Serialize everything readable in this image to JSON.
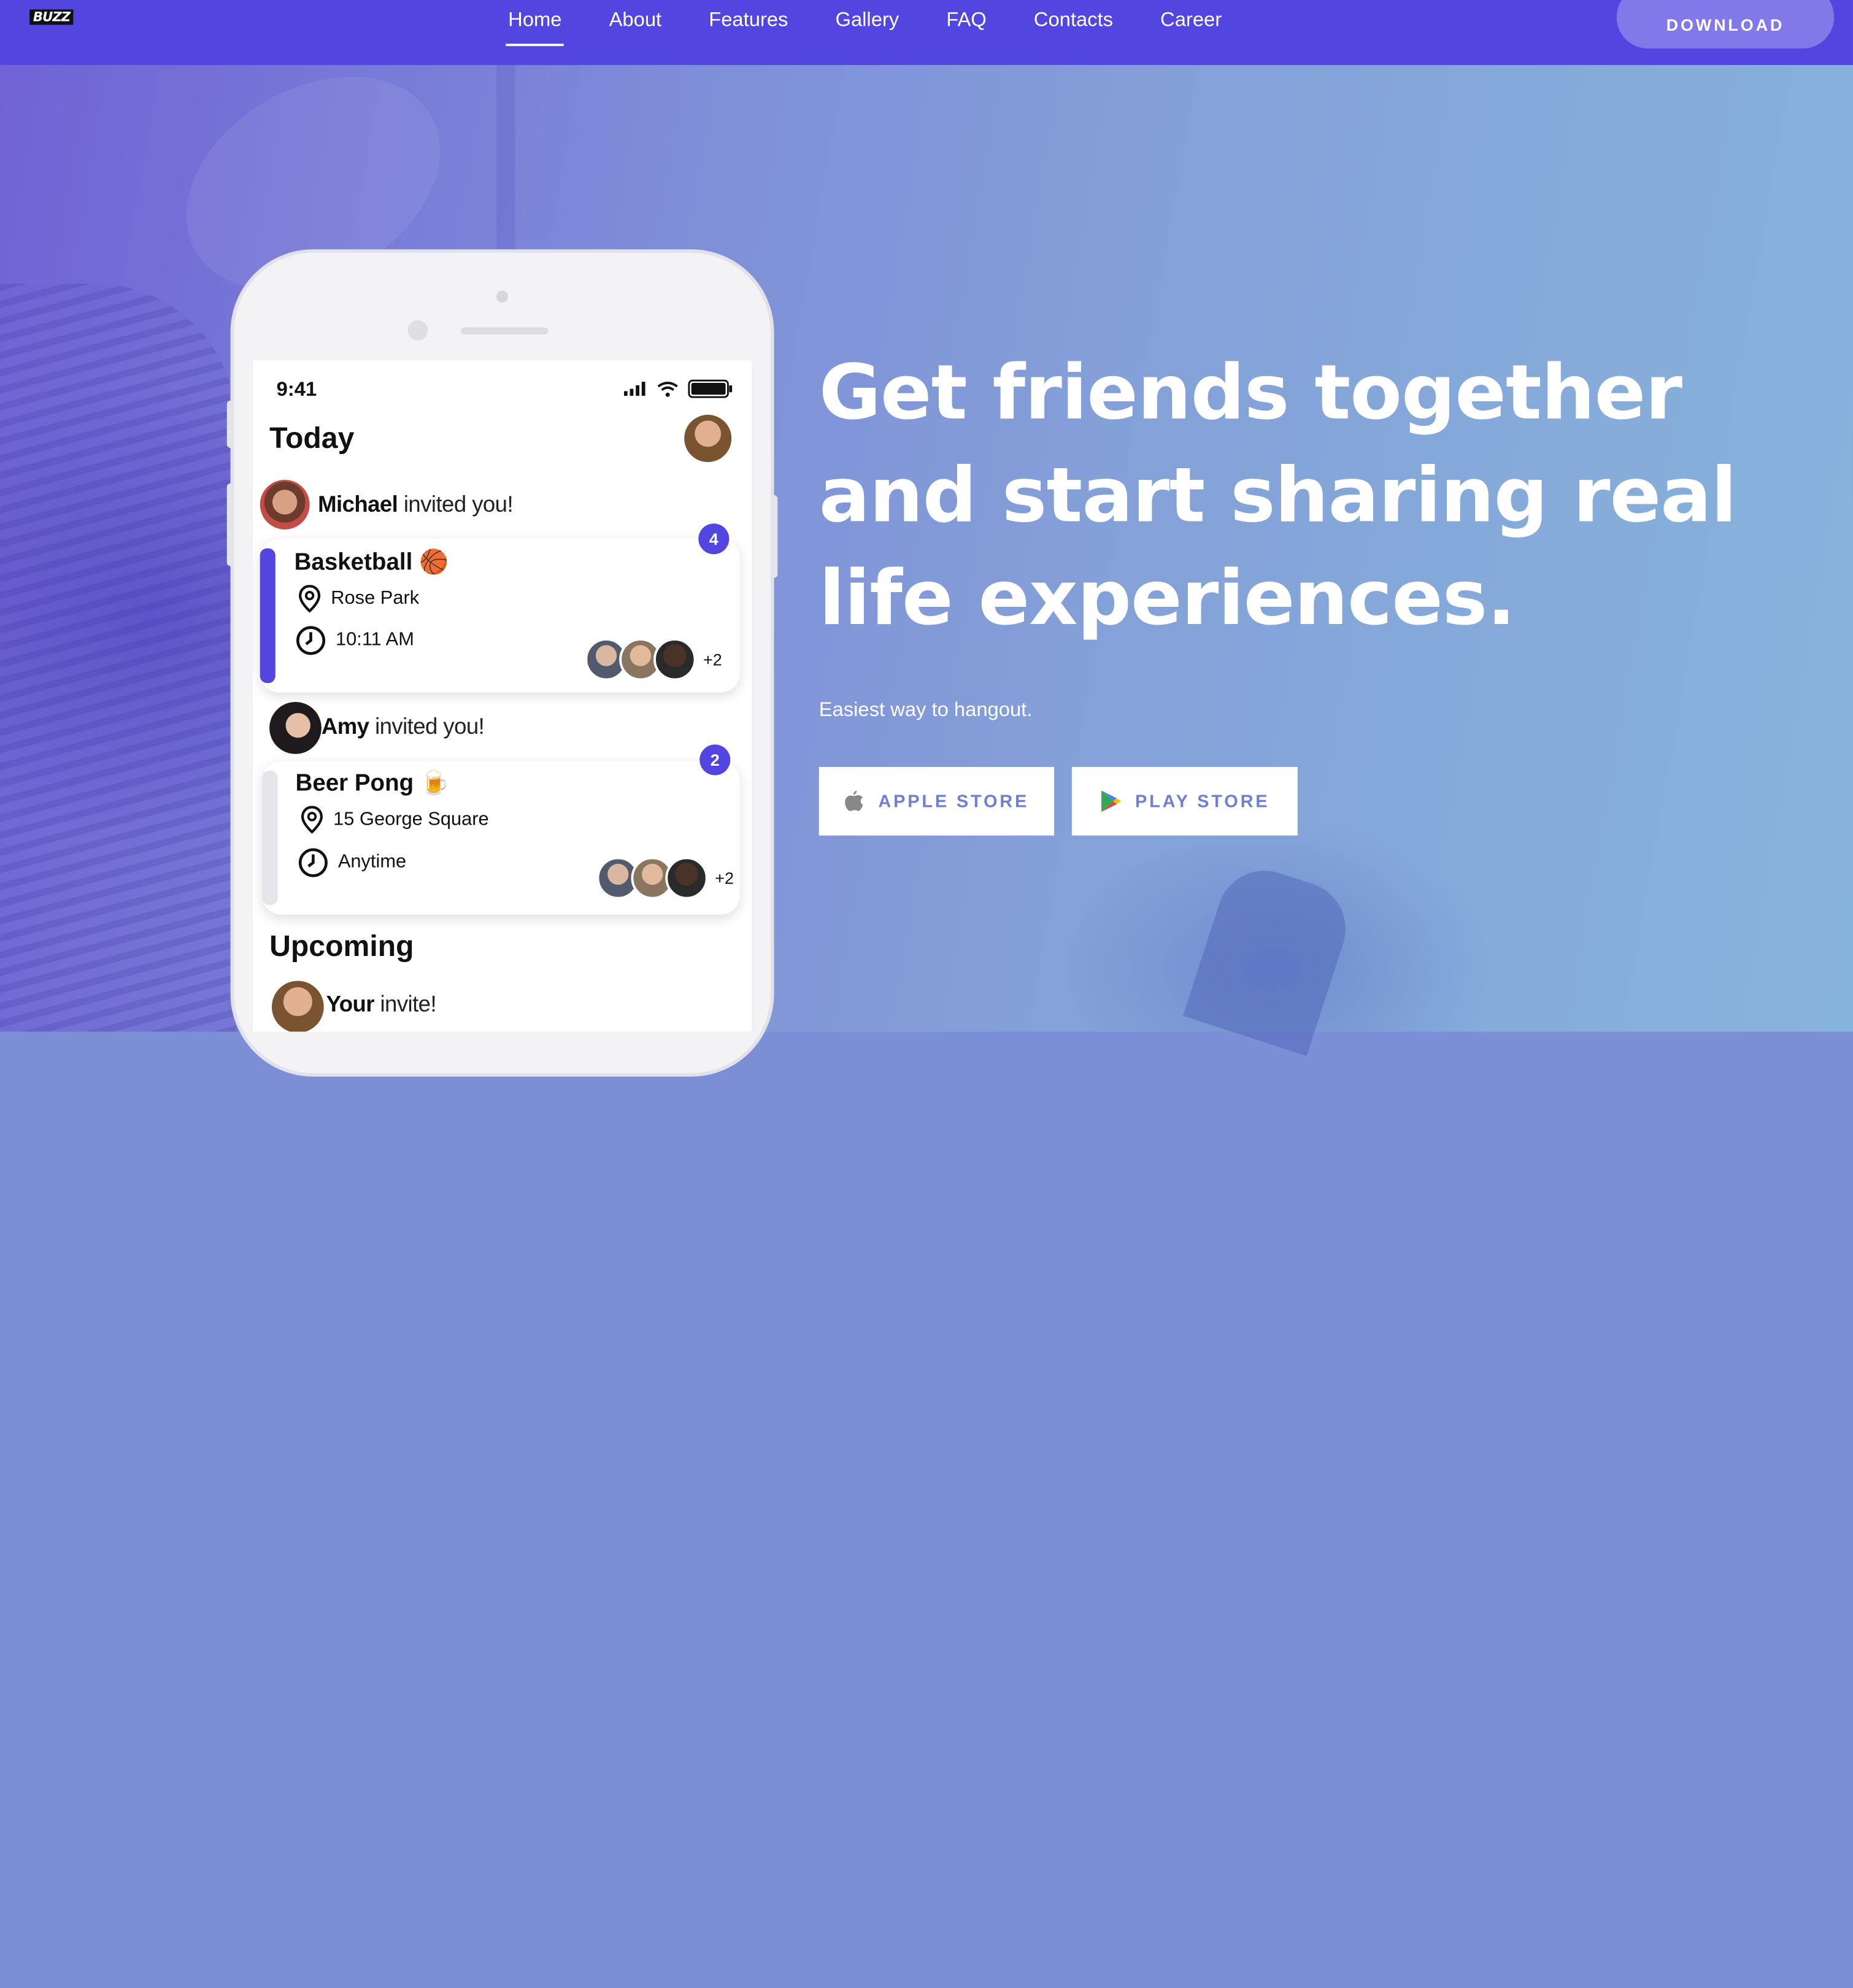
{
  "nav": {
    "logo": "BUZZ",
    "links": [
      "Home",
      "About",
      "Features",
      "Gallery",
      "FAQ",
      "Contacts",
      "Career"
    ],
    "active": "Home",
    "download_label": "DOWNLOAD"
  },
  "phone": {
    "time": "9:41",
    "today_heading": "Today",
    "upcoming_heading": "Upcoming",
    "invites": [
      {
        "name": "Michael",
        "text": " invited you!",
        "event": "Basketball",
        "emoji": "🏀",
        "location": "Rose Park",
        "time": "10:11 AM",
        "badge": "4",
        "extra": "+2",
        "accent": "#5346e0"
      },
      {
        "name": "Amy",
        "text": " invited you!",
        "event": "Beer Pong",
        "emoji": "🍺",
        "location": "15 George Square",
        "time": "Anytime",
        "badge": "2",
        "extra": "+2",
        "accent": "#e6e6ea"
      }
    ],
    "your_invite": {
      "name": "Your",
      "text": " invite!"
    }
  },
  "hero": {
    "headline_lines": [
      "Get friends together",
      "and start sharing real",
      "life experiences."
    ],
    "subline": "Easiest way to hangout.",
    "apple_label": "APPLE STORE",
    "play_label": "PLAY STORE"
  },
  "colors": {
    "nav": "#5346e0",
    "accent": "#5346e0",
    "store_text": "#6f7fd4"
  },
  "icons": [
    "apple-icon",
    "play-store-icon",
    "location-pin-icon",
    "clock-icon",
    "signal-icon",
    "wifi-icon",
    "battery-icon"
  ]
}
